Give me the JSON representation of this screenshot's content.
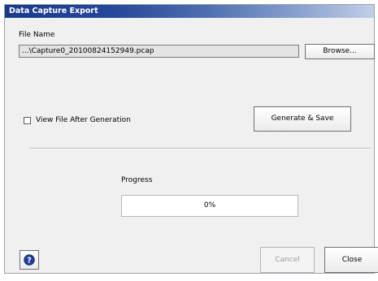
{
  "window": {
    "title": "Data Capture Export"
  },
  "file": {
    "label": "File Name",
    "value": "...\\Capture0_20100824152949.pcap",
    "browse_label": "Browse..."
  },
  "options": {
    "view_after_label": "View File After Generation",
    "view_after_checked": false
  },
  "actions": {
    "generate_label": "Generate & Save",
    "cancel_label": "Cancel",
    "close_label": "Close"
  },
  "progress": {
    "label": "Progress",
    "value_text": "0%",
    "fraction": 0
  },
  "icons": {
    "help": "help-icon"
  },
  "colors": {
    "title_bar": "#1a3a8c",
    "accent": "#1f3f9c"
  }
}
